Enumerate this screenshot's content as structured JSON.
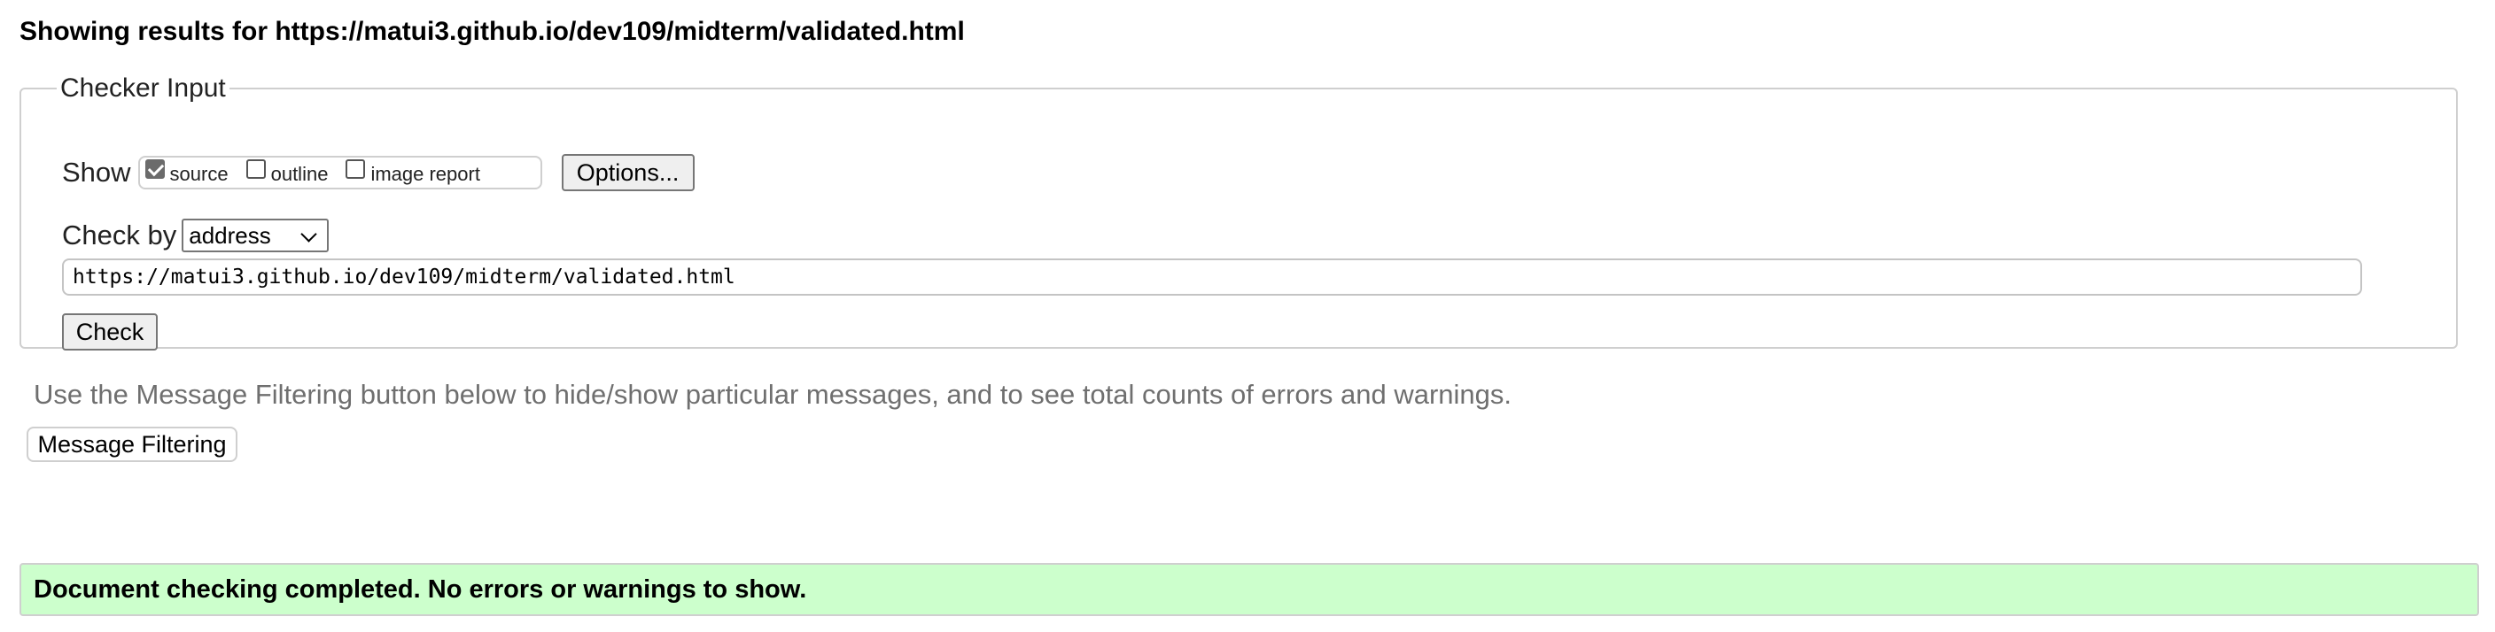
{
  "header": {
    "results_heading": "Showing results for https://matui3.github.io/dev109/midterm/validated.html"
  },
  "checker": {
    "legend": "Checker Input",
    "show_label": "Show",
    "show_options": [
      {
        "label": "source",
        "checked": true
      },
      {
        "label": "outline",
        "checked": false
      },
      {
        "label": "image report",
        "checked": false
      }
    ],
    "options_button": "Options...",
    "check_by_label": "Check by",
    "check_by_selected": "address",
    "url_value": "https://matui3.github.io/dev109/midterm/validated.html",
    "check_button": "Check"
  },
  "filtering": {
    "hint": "Use the Message Filtering button below to hide/show particular messages, and to see total counts of errors and warnings.",
    "button": "Message Filtering"
  },
  "result": {
    "message": "Document checking completed. No errors or warnings to show.",
    "background_color": "#ccffcc"
  },
  "icons": {
    "select_arrow": "chevron-down-icon",
    "checked_mark": "checkmark-icon"
  }
}
